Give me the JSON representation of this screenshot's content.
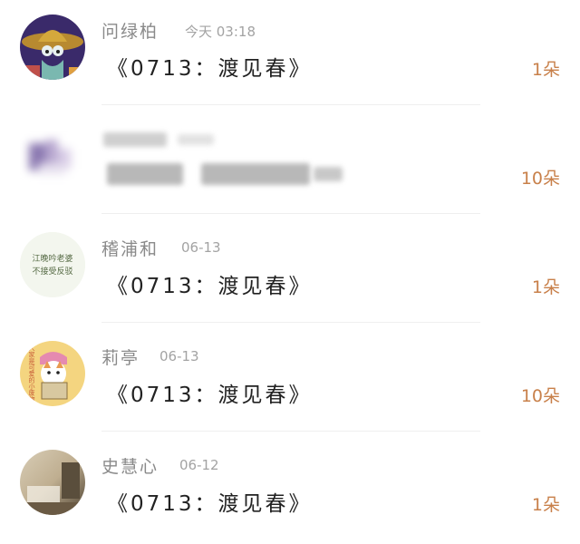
{
  "gifts": [
    {
      "name": "问绿柏",
      "time": "今天 03:18",
      "title": "《0713：渡见春》",
      "amount": "1朵"
    },
    {
      "name": "",
      "time": "",
      "title": "",
      "amount": "10朵"
    },
    {
      "name": "稽浦和",
      "time": "06-13",
      "title": "《0713：渡见春》",
      "amount": "1朵"
    },
    {
      "name": "莉亭",
      "time": "06-13",
      "title": "《0713：渡见春》",
      "amount": "10朵"
    },
    {
      "name": "史慧心",
      "time": "06-12",
      "title": "《0713：渡见春》",
      "amount": "1朵"
    }
  ],
  "avatars": [
    {
      "icon": "sombrero-cartoon-avatar",
      "colors": [
        "#3a2a6a",
        "#c8a040"
      ]
    },
    {
      "icon": "blurred-avatar",
      "colors": [
        "#7a6aa0",
        "#d8d0e0"
      ]
    },
    {
      "icon": "text-avatar",
      "colors": [
        "#f3f6ee",
        "#556a44"
      ],
      "text_line1": "江晚吟老婆",
      "text_line2": "不接受反驳"
    },
    {
      "icon": "cat-sticker-avatar",
      "colors": [
        "#f4d580",
        "#c8603a"
      ],
      "text": "人家是可爱的小废物"
    },
    {
      "icon": "room-photo-avatar",
      "colors": [
        "#cfc1a8",
        "#5a4e3c"
      ]
    }
  ],
  "accent_color": "#c8804a"
}
